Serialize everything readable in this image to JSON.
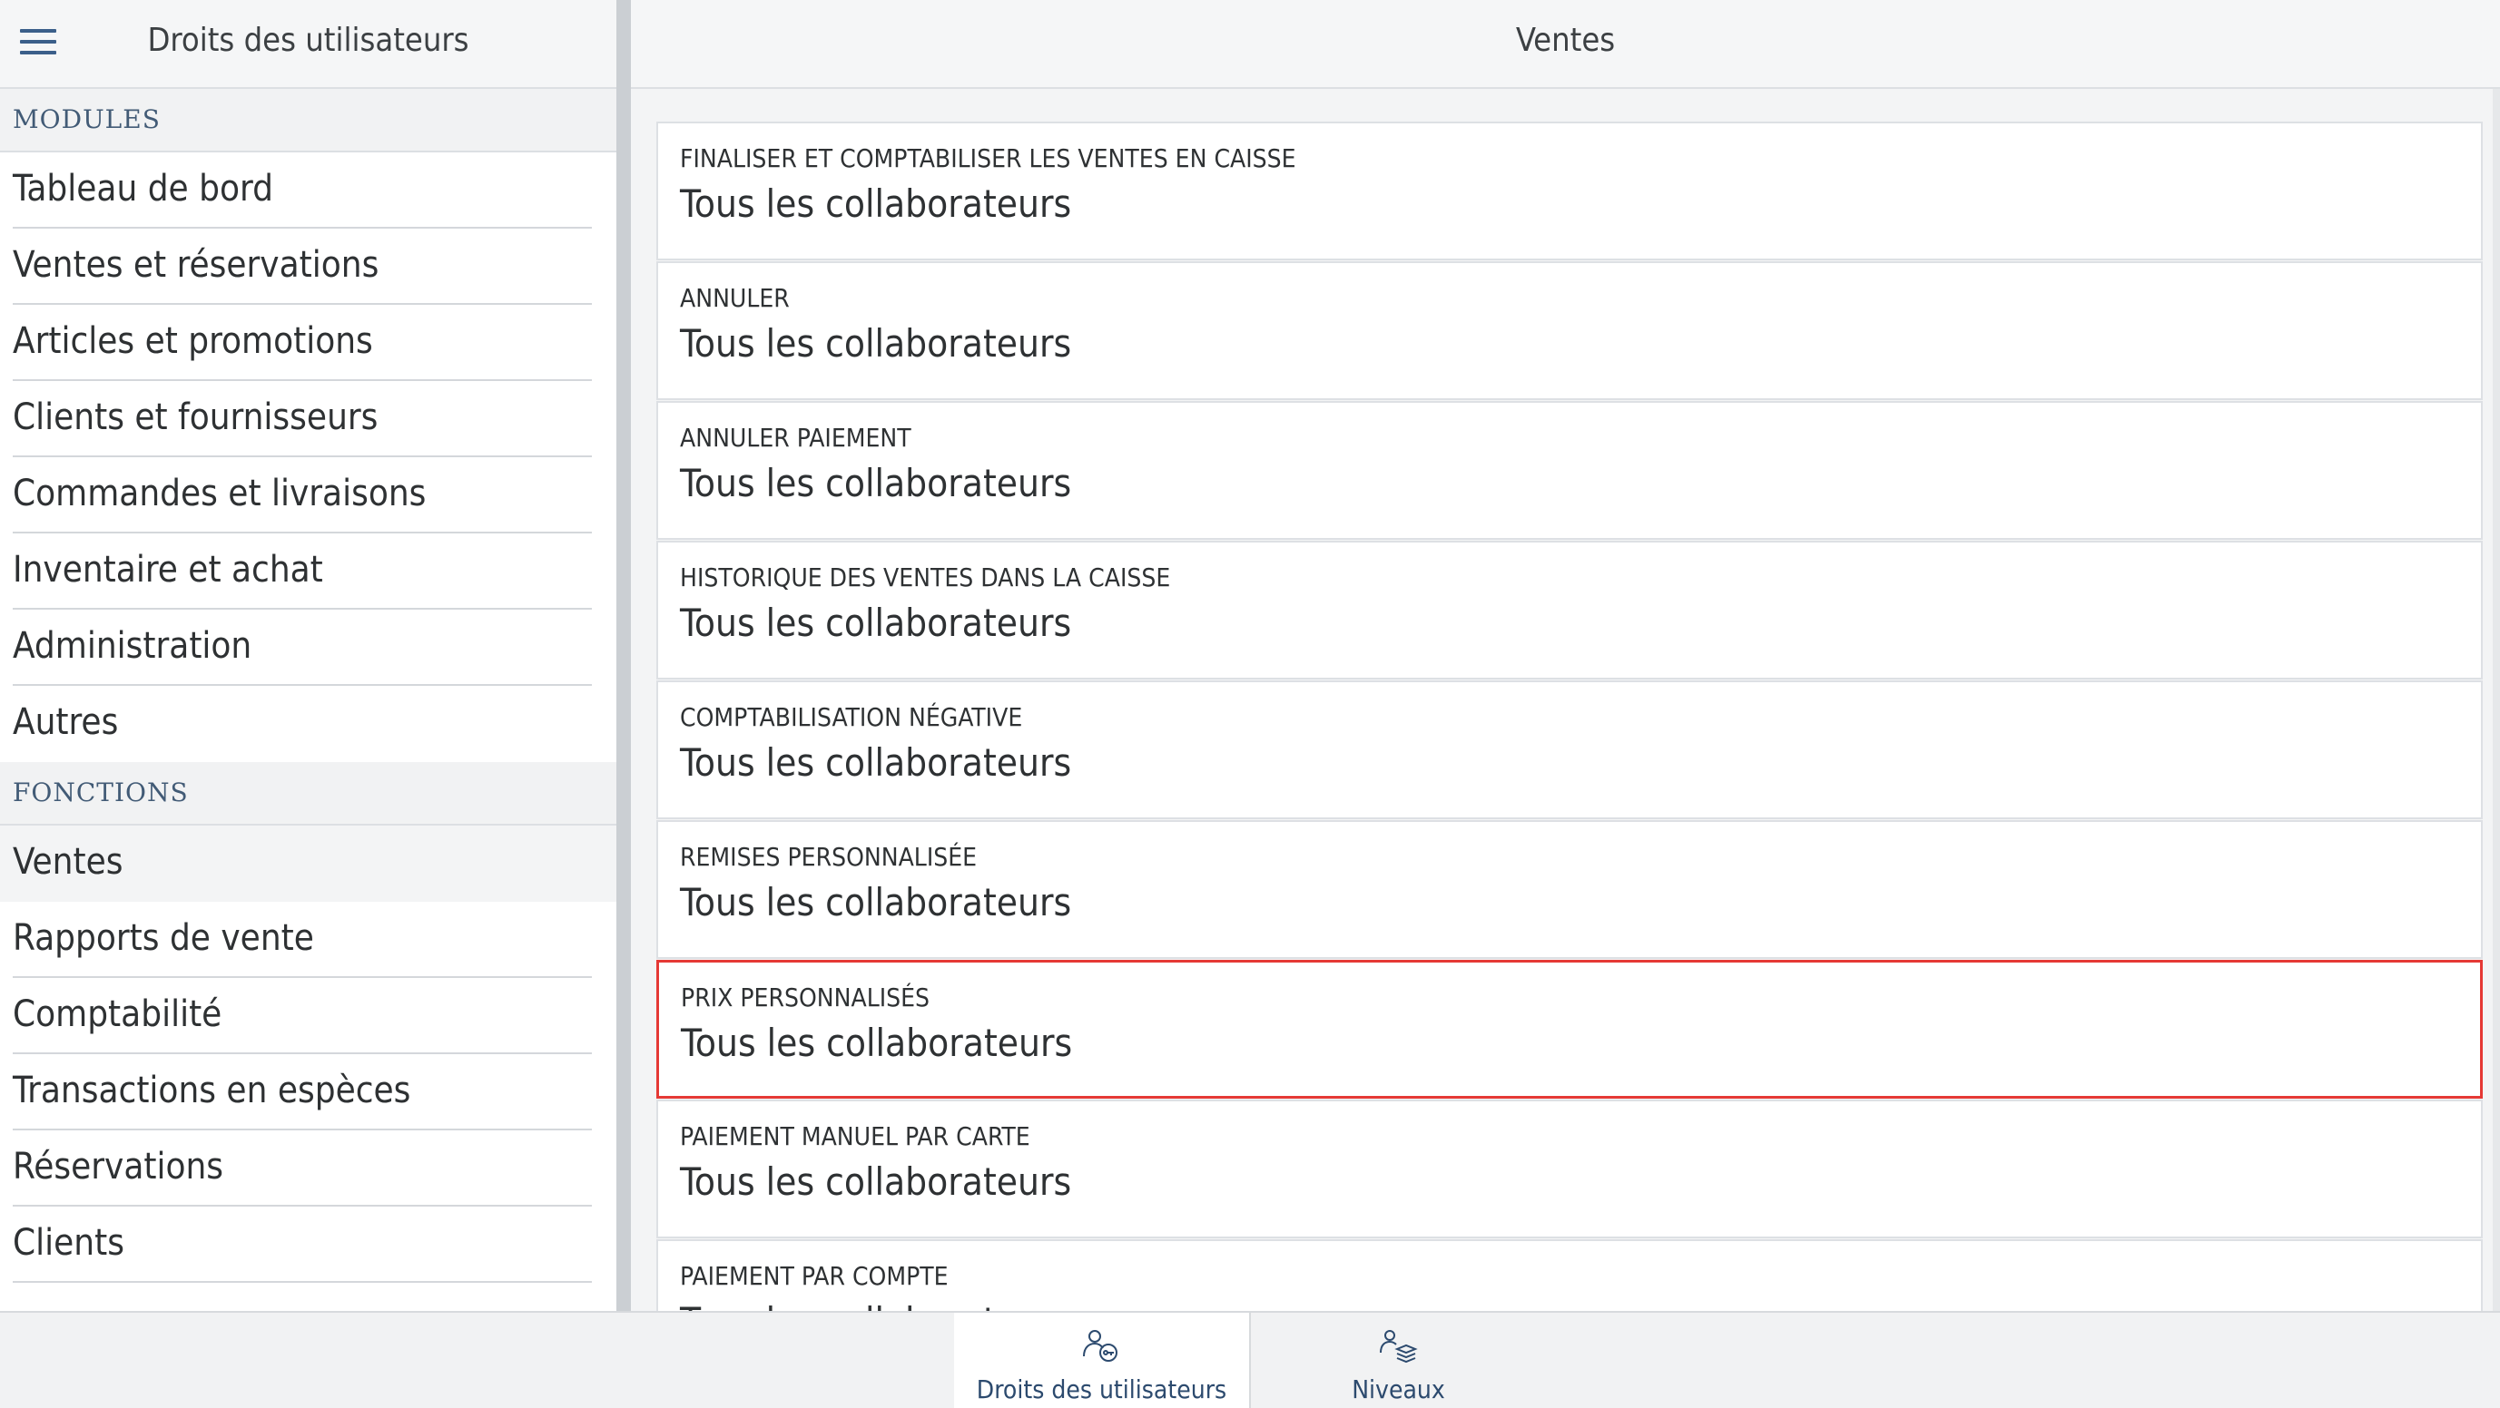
{
  "left_panel": {
    "title": "Droits des utilisateurs",
    "modules_header": "MODULES",
    "modules": [
      "Tableau de bord",
      "Ventes et réservations",
      "Articles et promotions",
      "Clients et fournisseurs",
      "Commandes et livraisons",
      "Inventaire et achat",
      "Administration",
      "Autres"
    ],
    "fonctions_header": "FONCTIONS",
    "fonctions": [
      "Ventes",
      "Rapports de vente",
      "Comptabilité",
      "Transactions en espèces",
      "Réservations",
      "Clients"
    ],
    "active_item": "Ventes"
  },
  "right_panel": {
    "title": "Ventes",
    "permissions": [
      {
        "label": "FINALISER ET COMPTABILISER LES VENTES EN CAISSE",
        "value": "Tous les collaborateurs"
      },
      {
        "label": "ANNULER",
        "value": "Tous les collaborateurs"
      },
      {
        "label": "ANNULER PAIEMENT",
        "value": "Tous les collaborateurs"
      },
      {
        "label": "HISTORIQUE DES VENTES DANS LA CAISSE",
        "value": "Tous les collaborateurs"
      },
      {
        "label": "COMPTABILISATION NÉGATIVE",
        "value": "Tous les collaborateurs"
      },
      {
        "label": "REMISES PERSONNALISÉE",
        "value": "Tous les collaborateurs"
      },
      {
        "label": "PRIX PERSONNALISÉS",
        "value": "Tous les collaborateurs",
        "highlighted": true
      },
      {
        "label": "PAIEMENT MANUEL PAR CARTE",
        "value": "Tous les collaborateurs"
      },
      {
        "label": "PAIEMENT PAR COMPTE",
        "value": "Tous les collaborateurs"
      }
    ]
  },
  "tabbar": {
    "tabs": [
      {
        "label": "Droits des utilisateurs",
        "icon": "users-key-icon",
        "active": true
      },
      {
        "label": "Niveaux",
        "icon": "users-layers-icon",
        "active": false
      }
    ]
  },
  "colors": {
    "accent": "#3b5f8a",
    "section_header_text": "#425b76",
    "highlight_border": "#e53935",
    "background": "#f3f4f5"
  }
}
